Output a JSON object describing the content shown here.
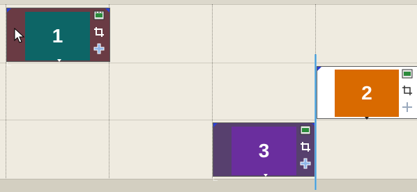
{
  "colors": {
    "background": "#efebe0",
    "selected_frame": "#6a3b44",
    "slide1": "#0d6566",
    "slide2": "#d96a00",
    "slide3": "#6a2e9e",
    "frame_unselected": "#ffffff",
    "insert_line": "#2f8fd1"
  },
  "slides": [
    {
      "number": "1",
      "state": "selected",
      "icons": [
        "film-icon",
        "crop-icon",
        "move-icon"
      ]
    },
    {
      "number": "2",
      "state": "normal",
      "icons": [
        "film-icon",
        "crop-icon",
        "move-icon"
      ]
    },
    {
      "number": "3",
      "state": "selected",
      "icons": [
        "film-icon",
        "crop-icon",
        "move-icon"
      ]
    }
  ],
  "cursor": {
    "icon": "arrow-cursor-icon"
  }
}
